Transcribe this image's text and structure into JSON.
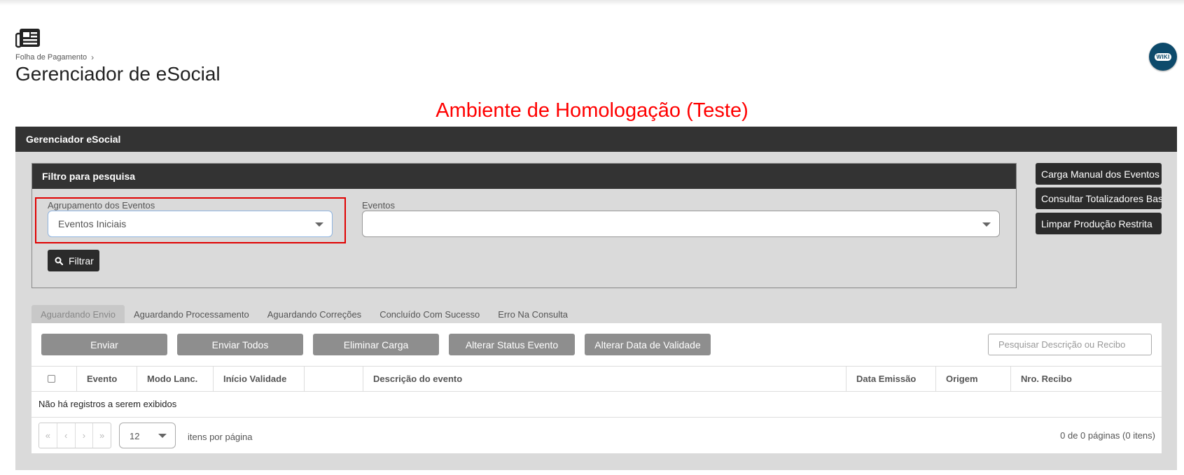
{
  "header": {
    "breadcrumb": "Folha de Pagamento",
    "breadcrumb_sep": "›",
    "title": "Gerenciador de eSocial",
    "wiki_label": "WIKI",
    "page_icon": "newspaper-icon"
  },
  "environment_banner": "Ambiente de Homologação (Teste)",
  "panel": {
    "title": "Gerenciador eSocial"
  },
  "filter": {
    "title": "Filtro para pesquisa",
    "grouping_label": "Agrupamento dos Eventos",
    "grouping_value": "Eventos Iniciais",
    "events_label": "Eventos",
    "events_value": "",
    "filter_button": "Filtrar",
    "filter_icon": "search-icon"
  },
  "side_buttons": [
    "Carga Manual dos Eventos",
    "Consultar Totalizadores Base",
    "Limpar Produção Restrita"
  ],
  "tabs": [
    "Aguardando Envio",
    "Aguardando Processamento",
    "Aguardando Correções",
    "Concluído Com Sucesso",
    "Erro Na Consulta"
  ],
  "actions": [
    "Enviar",
    "Enviar Todos",
    "Eliminar Carga",
    "Alterar Status Evento",
    "Alterar Data de Validade"
  ],
  "search": {
    "placeholder": "Pesquisar Descrição ou Recibo"
  },
  "table": {
    "columns": [
      "Evento",
      "Modo Lanc.",
      "Início Validade",
      "",
      "Descrição do evento",
      "Data Emissão",
      "Origem",
      "Nro. Recibo"
    ],
    "empty_message": "Não há registros a serem exibidos"
  },
  "pagination": {
    "first": "«",
    "prev": "‹",
    "next": "›",
    "last": "»",
    "page_size": "12",
    "items_per_page_label": "itens por página",
    "info": "0 de 0 páginas (0 itens)"
  },
  "colors": {
    "dark": "#333333",
    "banner": "#ff0000",
    "highlight_border": "#e00000",
    "action_button": "#8e8e8e",
    "wiki": "#0d4a6b"
  }
}
